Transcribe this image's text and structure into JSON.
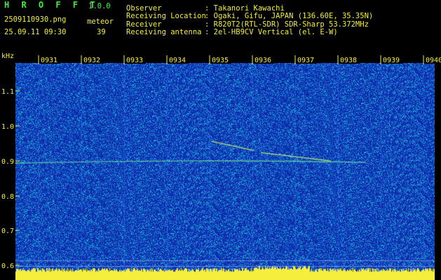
{
  "header": {
    "app_name": "H R O F F T",
    "version": "1.0.0",
    "filename": "2509110930.png",
    "category": "meteor",
    "datetime": "25.09.11 09:30",
    "count": "39"
  },
  "station": {
    "labels": [
      "Observer",
      "Receiving Location",
      "Receiver",
      "Receiving antenna"
    ],
    "values": [
      ": Takanori Kawachi",
      ": Ogaki, Gifu, JAPAN (136.60E, 35.35N)",
      ": R820T2(RTL-SDR) SDR-Sharp 53.372MHz",
      ": 2el-HB9CV Vertical (el. E-W)"
    ]
  },
  "axes": {
    "y_unit": "kHz",
    "y_ticks": [
      "1.1",
      "1.0",
      "0.9",
      "0.8",
      "0.7",
      "0.6"
    ],
    "x_ticks": [
      "0931",
      "0932",
      "0933",
      "0934",
      "0935",
      "0936",
      "0937",
      "0938",
      "0939",
      "0940"
    ]
  },
  "colors": {
    "background": "#000000",
    "label_green": "#3ef03e",
    "label_yellow": "#f6ee3c",
    "noise_low": "#0b2aa8",
    "noise_high": "#22c8e6",
    "baseline": "#f6ee3c"
  }
}
